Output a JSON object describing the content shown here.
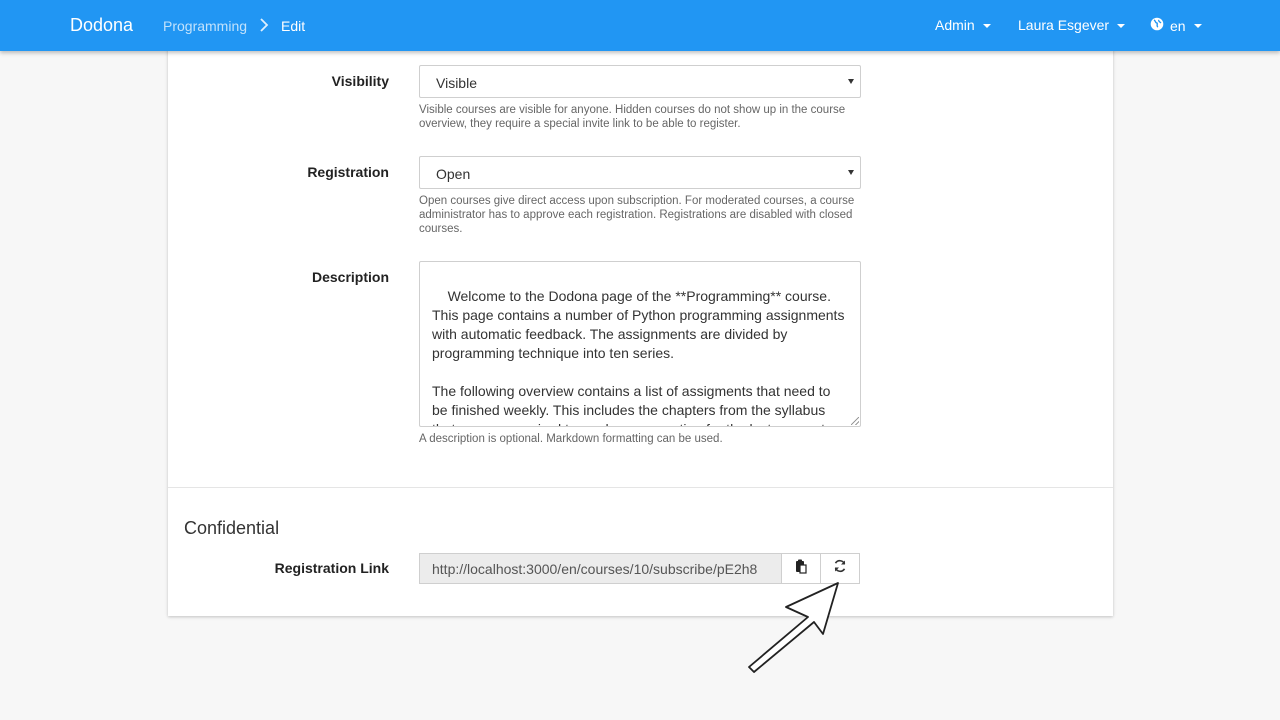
{
  "navbar": {
    "brand": "Dodona",
    "breadcrumb": [
      "Programming",
      "Edit"
    ],
    "admin_label": "Admin",
    "user_label": "Laura Esgever",
    "lang_label": "en",
    "color": "#2196f3"
  },
  "form": {
    "visibility": {
      "label": "Visibility",
      "value": "Visible",
      "help": "Visible courses are visible for anyone. Hidden courses do not show up in the course overview, they require a special invite link to be able to register."
    },
    "registration": {
      "label": "Registration",
      "value": "Open",
      "help": "Open courses give direct access upon subscription. For moderated courses, a course administrator has to approve each registration. Registrations are disabled with closed courses."
    },
    "description": {
      "label": "Description",
      "value": "Welcome to the Dodona page of the **Programming** course. This page contains a number of Python programming assignments with automatic feedback. The assignments are divided by programming technique into ten series.\n\nThe following overview contains a list of assigments that need to be finished weekly. This includes the chapters from the syllabus that you are required to read as preparation for the lectures, extra assignments you can practice for solving the series, and optional",
      "help": "A description is optional. Markdown formatting can be used."
    }
  },
  "confidential": {
    "title": "Confidential",
    "registration_link_label": "Registration Link",
    "registration_link_value": "http://localhost:3000/en/courses/10/subscribe/pE2h8"
  },
  "icons": {
    "copy": "clipboard-icon",
    "refresh": "refresh-icon",
    "lang": "globe-icon"
  }
}
